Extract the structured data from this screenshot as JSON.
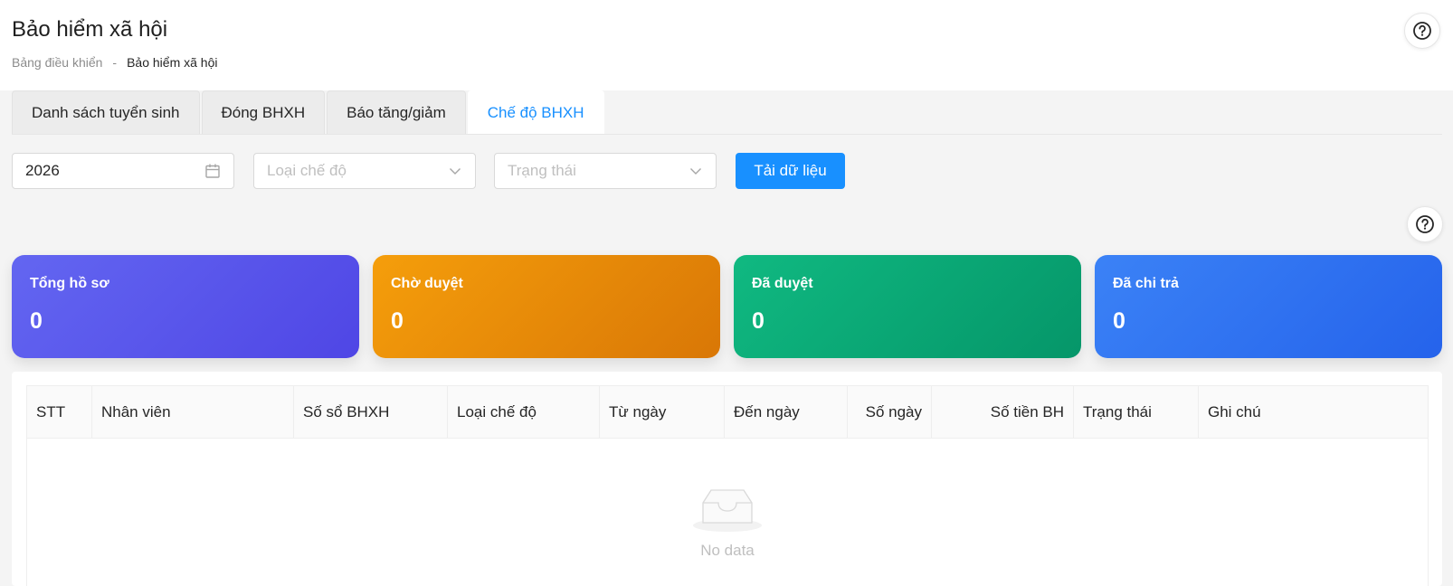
{
  "header": {
    "title": "Bảo hiểm xã hội",
    "breadcrumb": {
      "home": "Bảng điều khiển",
      "separator": "-",
      "current": "Bảo hiểm xã hội"
    }
  },
  "tabs": [
    {
      "label": "Danh sách tuyển sinh",
      "active": false
    },
    {
      "label": "Đóng BHXH",
      "active": false
    },
    {
      "label": "Báo tăng/giảm",
      "active": false
    },
    {
      "label": "Chế độ BHXH",
      "active": true
    }
  ],
  "filters": {
    "year": {
      "value": "2026",
      "icon": "calendar-icon"
    },
    "type": {
      "placeholder": "Loại chế độ",
      "icon": "chevron-down-icon"
    },
    "status": {
      "placeholder": "Trạng thái",
      "icon": "chevron-down-icon"
    },
    "load_button": "Tải dữ liệu"
  },
  "stats": [
    {
      "label": "Tổng hồ sơ",
      "value": "0",
      "color": "#4f46e5"
    },
    {
      "label": "Chờ duyệt",
      "value": "0",
      "color": "#d97706"
    },
    {
      "label": "Đã duyệt",
      "value": "0",
      "color": "#059669"
    },
    {
      "label": "Đã chi trả",
      "value": "0",
      "color": "#2563eb"
    }
  ],
  "table": {
    "columns": [
      "STT",
      "Nhân viên",
      "Số sổ BHXH",
      "Loại chế độ",
      "Từ ngày",
      "Đến ngày",
      "Số ngày",
      "Số tiền BH",
      "Trạng thái",
      "Ghi chú"
    ],
    "empty_text": "No data"
  },
  "colors": {
    "primary": "#1890ff"
  }
}
